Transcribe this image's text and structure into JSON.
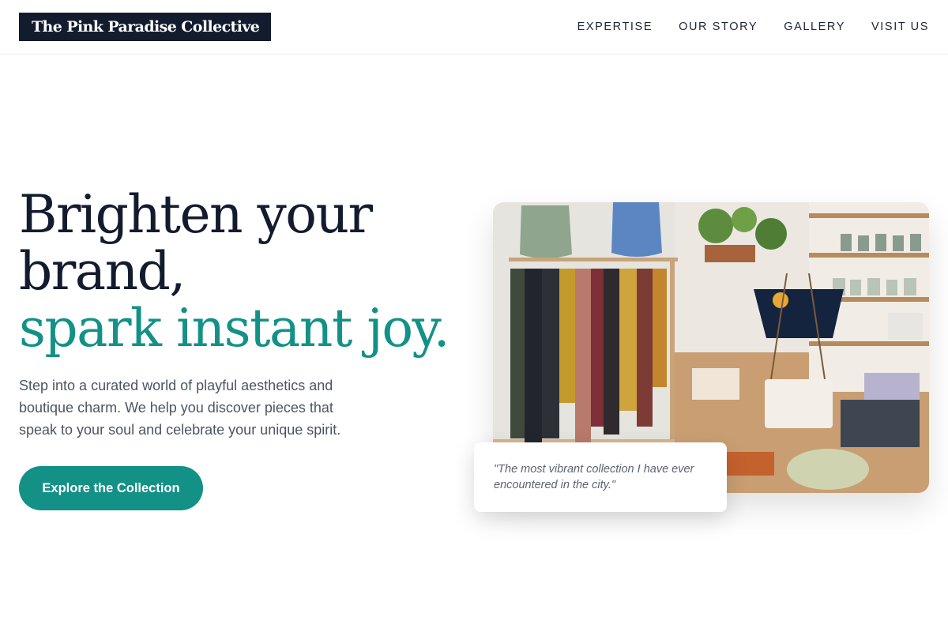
{
  "brand": {
    "name": "The Pink Paradise Collective"
  },
  "nav": {
    "items": [
      {
        "label": "EXPERTISE"
      },
      {
        "label": "OUR STORY"
      },
      {
        "label": "GALLERY"
      },
      {
        "label": "VISIT US"
      }
    ]
  },
  "hero": {
    "title_line1": "Brighten your",
    "title_line2": "brand,",
    "title_accent": "spark instant joy.",
    "description": "Step into a curated world of playful aesthetics and boutique charm. We help you discover pieces that speak to your soul and celebrate your unique spirit.",
    "cta_label": "Explore the Collection"
  },
  "testimonial": {
    "quote": "\"The most vibrant collection I have ever encountered in the city.\""
  },
  "image": {
    "subject": "boutique interior with clothing rack, backpacks, plants and shelves of ceramics"
  },
  "colors": {
    "brand_dark": "#131b2e",
    "accent": "#139187",
    "text_muted": "#4b5563"
  }
}
